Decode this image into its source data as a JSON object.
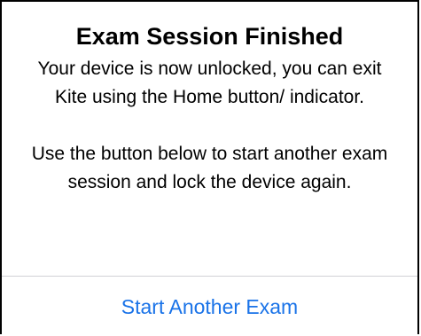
{
  "dialog": {
    "title": "Exam Session Finished",
    "message_paragraph_1": "Your device is now unlocked, you can exit Kite using the Home button/ indicator.",
    "message_paragraph_2": "Use the button below to start another exam session and lock the device again.",
    "action_label": "Start Another Exam"
  },
  "colors": {
    "accent": "#1a73e8",
    "divider": "#d1d1d6",
    "border": "#000000"
  }
}
